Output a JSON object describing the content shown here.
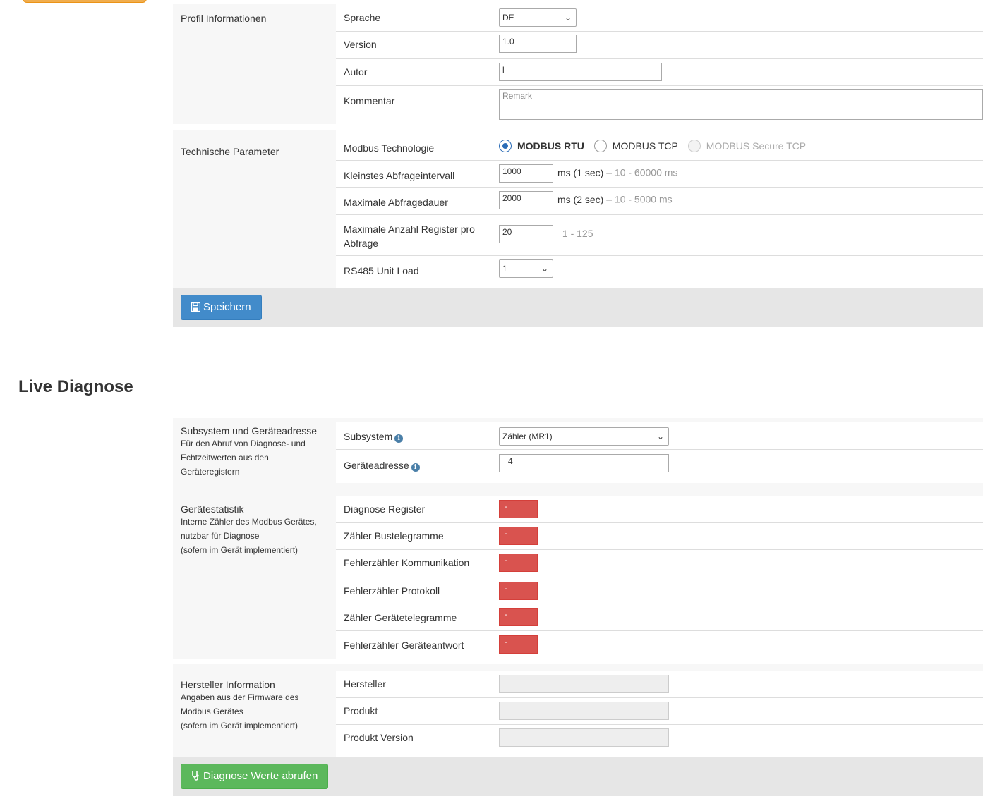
{
  "profile": {
    "section_title": "Profil Informationen",
    "language": {
      "label": "Sprache",
      "value": "DE"
    },
    "version": {
      "label": "Version",
      "value": "1.0"
    },
    "author": {
      "label": "Autor",
      "value": "l"
    },
    "comment": {
      "label": "Kommentar",
      "placeholder": "Remark"
    }
  },
  "tech": {
    "section_title": "Technische Parameter",
    "modbus": {
      "label": "Modbus Technologie",
      "options": [
        "MODBUS RTU",
        "MODBUS TCP",
        "MODBUS Secure TCP"
      ],
      "selected": "MODBUS RTU"
    },
    "min_interval": {
      "label": "Kleinstes Abfrageintervall",
      "value": "1000",
      "unit": "ms (1 sec)",
      "hint": "– 10 - 60000 ms"
    },
    "max_duration": {
      "label": "Maximale Abfragedauer",
      "value": "2000",
      "unit": "ms (2 sec)",
      "hint": "– 10 - 5000 ms"
    },
    "max_registers": {
      "label": "Maximale Anzahl Register pro Abfrage",
      "value": "20",
      "hint": "1 - 125"
    },
    "unit_load": {
      "label": "RS485 Unit Load",
      "value": "1"
    }
  },
  "save_button": {
    "label": "Speichern"
  },
  "live_title": "Live Diagnose",
  "subsystem": {
    "section_title": "Subsystem und Geräteadresse",
    "desc": "Für den Abruf von Diagnose- und Echtzeitwerten aus den Geräteregistern",
    "subsystem": {
      "label": "Subsystem",
      "value": "Zähler (MR1)"
    },
    "address": {
      "label": "Geräteadresse",
      "value": "4"
    }
  },
  "stats": {
    "section_title": "Gerätestatistik",
    "desc": "Interne Zähler des Modbus Gerätes, nutzbar für Diagnose",
    "desc2": "(sofern im Gerät implementiert)",
    "rows": [
      {
        "label": "Diagnose Register",
        "value": "-"
      },
      {
        "label": "Zähler Bustelegramme",
        "value": "-"
      },
      {
        "label": "Fehlerzähler Kommunikation",
        "value": "-"
      },
      {
        "label": "Fehlerzähler Protokoll",
        "value": "-"
      },
      {
        "label": "Zähler Gerätetelegramme",
        "value": "-"
      },
      {
        "label": "Fehlerzähler Geräteantwort",
        "value": "-"
      }
    ]
  },
  "vendor": {
    "section_title": "Hersteller Information",
    "desc": "Angaben aus der Firmware des Modbus Gerätes",
    "desc2": "(sofern im Gerät implementiert)",
    "rows": [
      {
        "label": "Hersteller",
        "value": ""
      },
      {
        "label": "Produkt",
        "value": ""
      },
      {
        "label": "Produkt Version",
        "value": ""
      }
    ]
  },
  "diag_button": {
    "label": "Diagnose Werte abrufen"
  },
  "colors": {
    "primary": "#428bca",
    "success": "#5cb85c",
    "danger": "#d9534f"
  }
}
